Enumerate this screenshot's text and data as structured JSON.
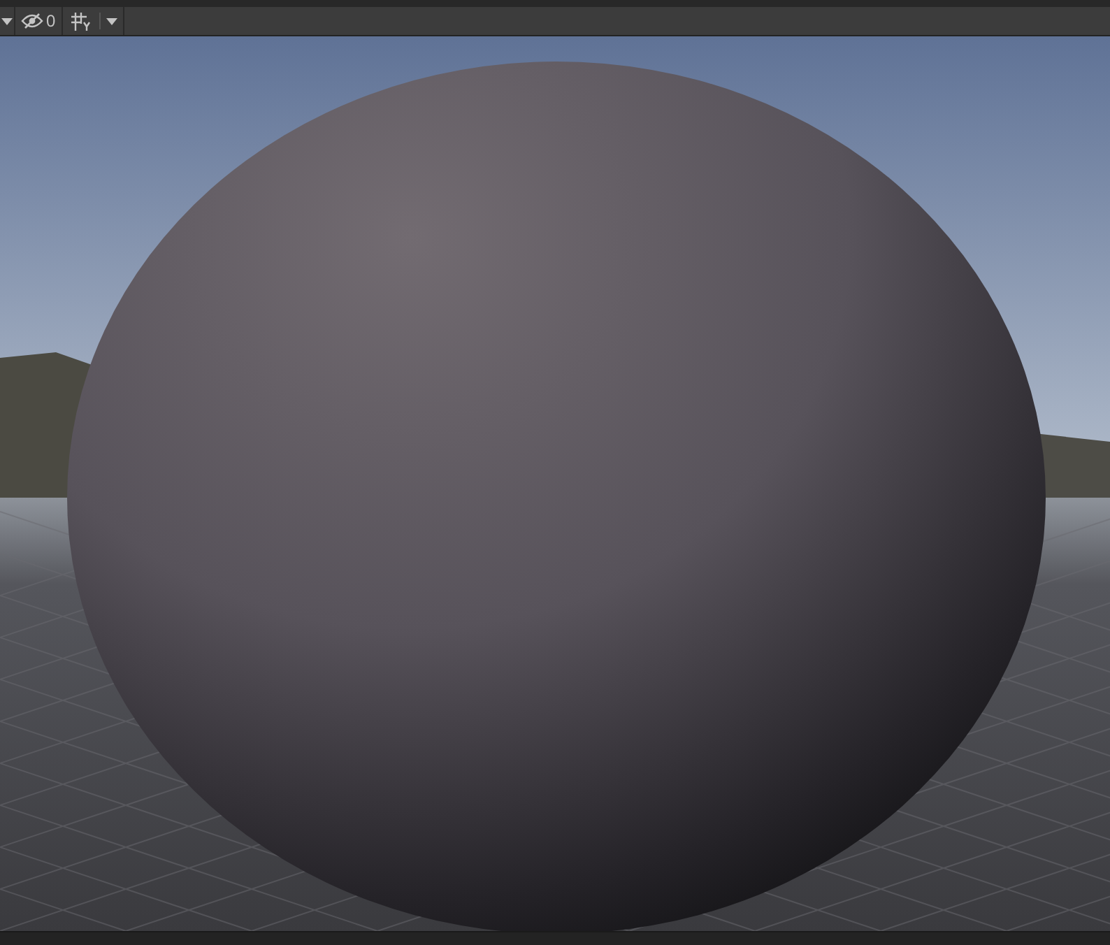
{
  "toolbar": {
    "hidden_count": "0"
  }
}
